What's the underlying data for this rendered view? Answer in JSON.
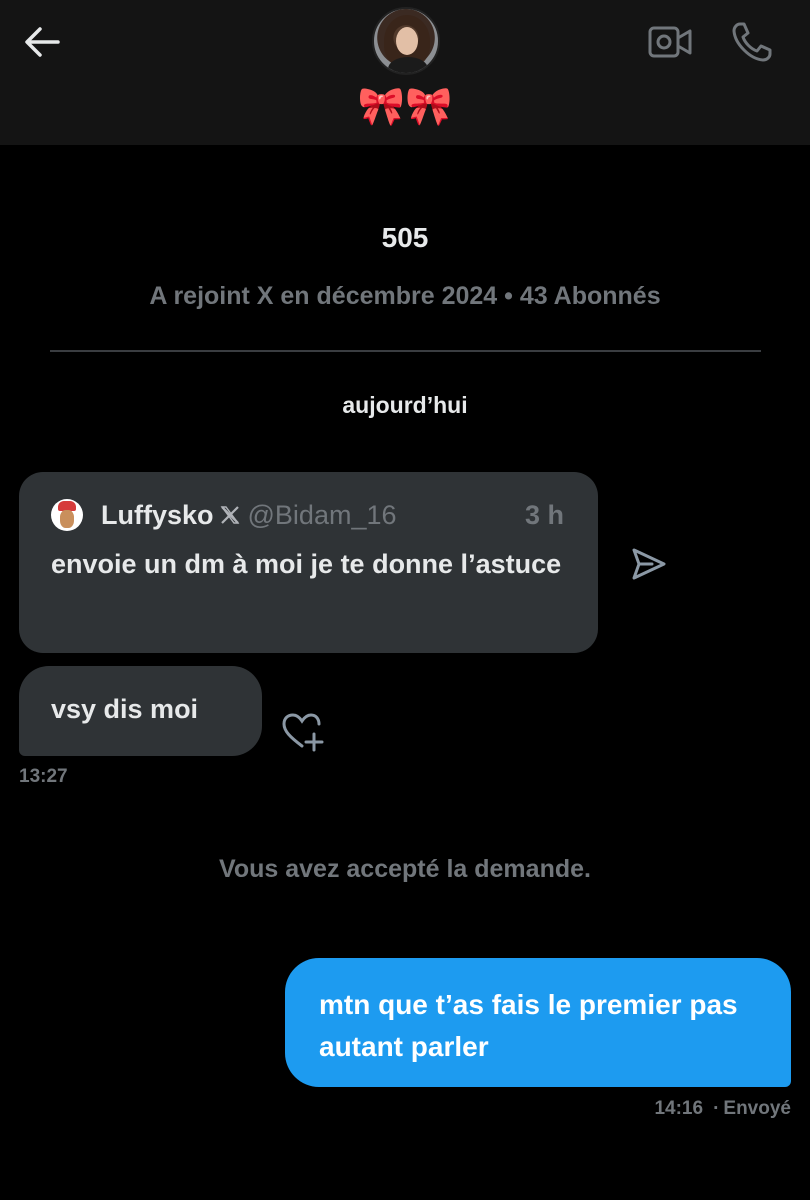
{
  "header": {
    "display_name_emoji": "🎀🎀",
    "icons": {
      "back": "arrow-left-icon",
      "video": "video-camera-icon",
      "phone": "phone-icon"
    }
  },
  "profile": {
    "handle": "505",
    "meta": "A rejoint X en décembre 2024 • 43 Abonnés"
  },
  "conversation": {
    "date_label": "aujourd’hui",
    "quoted_post": {
      "name": "Luffysko",
      "username": "@Bidam_16",
      "time": "3 h",
      "text": "envoie un dm à moi je te donne l’astuce"
    },
    "incoming_message": {
      "text": "vsy dis moi",
      "time": "13:27"
    },
    "system_note": "Vous avez accepté la demande.",
    "outgoing_message": {
      "text": "mtn que t’as fais le premier pas autant parler",
      "time": "14:16",
      "status": "Envoyé"
    }
  },
  "colors": {
    "background": "#000000",
    "header": "#141414",
    "bubble_incoming": "#2f3336",
    "bubble_outgoing": "#1d9bf0",
    "muted_text": "#71767b"
  }
}
